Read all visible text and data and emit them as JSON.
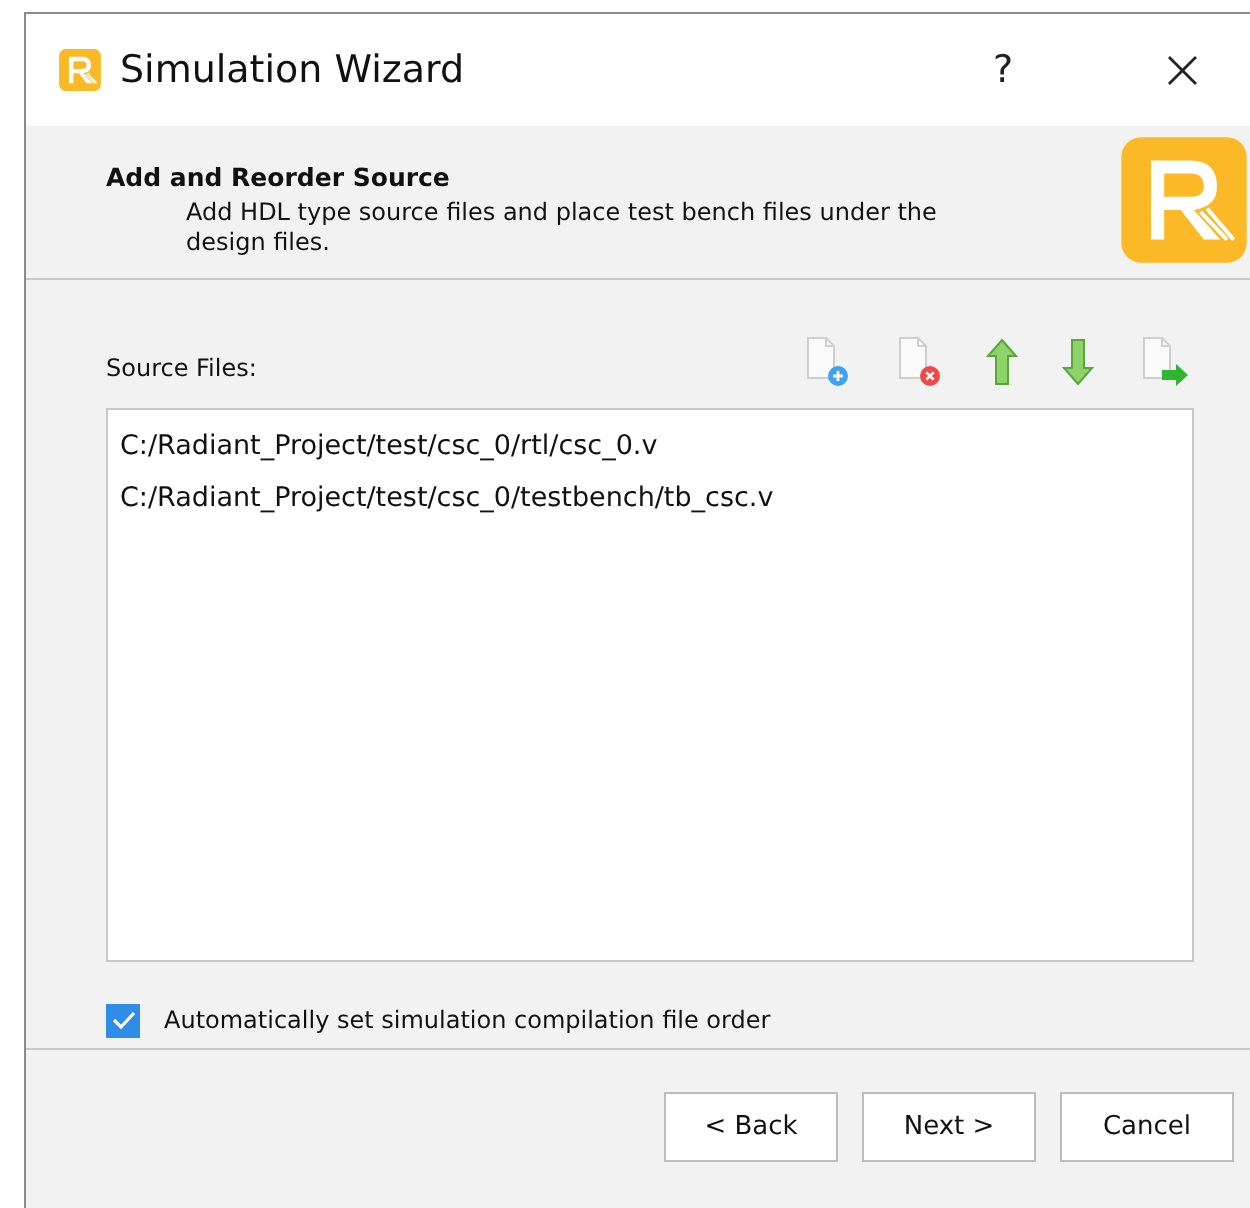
{
  "window": {
    "title": "Simulation Wizard",
    "help": "?",
    "close": "×"
  },
  "header": {
    "title": "Add and Reorder Source",
    "description": "Add HDL type source files and place test bench files under the design files."
  },
  "source_files": {
    "label": "Source Files:",
    "toolbar": [
      {
        "kind": "add"
      },
      {
        "kind": "remove"
      },
      {
        "kind": "up"
      },
      {
        "kind": "down"
      },
      {
        "kind": "import"
      }
    ],
    "items": [
      "C:/Radiant_Project/test/csc_0/rtl/csc_0.v",
      "C:/Radiant_Project/test/csc_0/testbench/tb_csc.v"
    ]
  },
  "auto_order": {
    "label": "Automatically set simulation compilation file order",
    "checked": true
  },
  "buttons": [
    "< Back",
    "Next >",
    "Cancel"
  ]
}
